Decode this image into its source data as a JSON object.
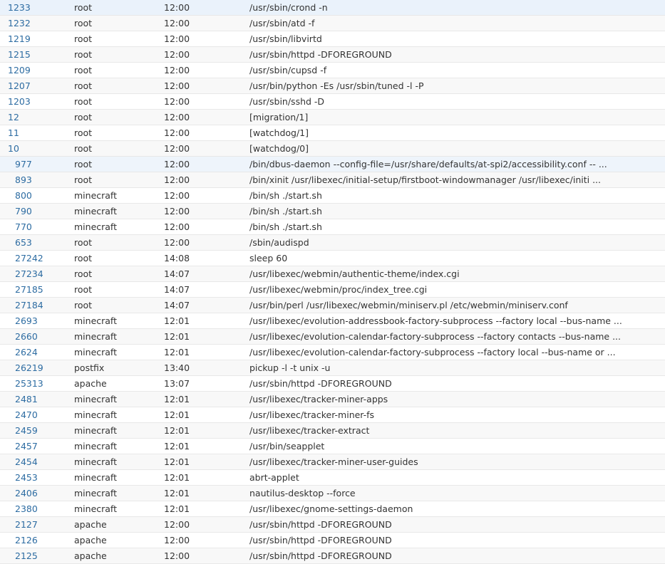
{
  "process_table": {
    "rows": [
      {
        "pid": "1233",
        "owner": "root",
        "started": "12:00",
        "command": "/usr/sbin/crond -n",
        "level": 0
      },
      {
        "pid": "1232",
        "owner": "root",
        "started": "12:00",
        "command": "/usr/sbin/atd -f",
        "level": 0
      },
      {
        "pid": "1219",
        "owner": "root",
        "started": "12:00",
        "command": "/usr/sbin/libvirtd",
        "level": 0
      },
      {
        "pid": "1215",
        "owner": "root",
        "started": "12:00",
        "command": "/usr/sbin/httpd -DFOREGROUND",
        "level": 0
      },
      {
        "pid": "1209",
        "owner": "root",
        "started": "12:00",
        "command": "/usr/sbin/cupsd -f",
        "level": 0
      },
      {
        "pid": "1207",
        "owner": "root",
        "started": "12:00",
        "command": "/usr/bin/python -Es /usr/sbin/tuned -l -P",
        "level": 0
      },
      {
        "pid": "1203",
        "owner": "root",
        "started": "12:00",
        "command": "/usr/sbin/sshd -D",
        "level": 0
      },
      {
        "pid": "12",
        "owner": "root",
        "started": "12:00",
        "command": "[migration/1]",
        "level": 0
      },
      {
        "pid": "11",
        "owner": "root",
        "started": "12:00",
        "command": "[watchdog/1]",
        "level": 0
      },
      {
        "pid": "10",
        "owner": "root",
        "started": "12:00",
        "command": "[watchdog/0]",
        "level": 0
      },
      {
        "pid": "977",
        "owner": "root",
        "started": "12:00",
        "command": "/bin/dbus-daemon --config-file=/usr/share/defaults/at-spi2/accessibility.conf -- ...",
        "level": 1,
        "highlight": true
      },
      {
        "pid": "893",
        "owner": "root",
        "started": "12:00",
        "command": "/bin/xinit /usr/libexec/initial-setup/firstboot-windowmanager /usr/libexec/initi ...",
        "level": 1
      },
      {
        "pid": "800",
        "owner": "minecraft",
        "started": "12:00",
        "command": "/bin/sh ./start.sh",
        "level": 1
      },
      {
        "pid": "790",
        "owner": "minecraft",
        "started": "12:00",
        "command": "/bin/sh ./start.sh",
        "level": 1
      },
      {
        "pid": "770",
        "owner": "minecraft",
        "started": "12:00",
        "command": "/bin/sh ./start.sh",
        "level": 1
      },
      {
        "pid": "653",
        "owner": "root",
        "started": "12:00",
        "command": "/sbin/audispd",
        "level": 1
      },
      {
        "pid": "27242",
        "owner": "root",
        "started": "14:08",
        "command": "sleep 60",
        "level": 1
      },
      {
        "pid": "27234",
        "owner": "root",
        "started": "14:07",
        "command": "/usr/libexec/webmin/authentic-theme/index.cgi",
        "level": 1
      },
      {
        "pid": "27185",
        "owner": "root",
        "started": "14:07",
        "command": "/usr/libexec/webmin/proc/index_tree.cgi",
        "level": 1
      },
      {
        "pid": "27184",
        "owner": "root",
        "started": "14:07",
        "command": "/usr/bin/perl /usr/libexec/webmin/miniserv.pl /etc/webmin/miniserv.conf",
        "level": 1
      },
      {
        "pid": "2693",
        "owner": "minecraft",
        "started": "12:01",
        "command": "/usr/libexec/evolution-addressbook-factory-subprocess --factory local --bus-name ...",
        "level": 1
      },
      {
        "pid": "2660",
        "owner": "minecraft",
        "started": "12:01",
        "command": "/usr/libexec/evolution-calendar-factory-subprocess --factory contacts --bus-name ...",
        "level": 1
      },
      {
        "pid": "2624",
        "owner": "minecraft",
        "started": "12:01",
        "command": "/usr/libexec/evolution-calendar-factory-subprocess --factory local --bus-name or ...",
        "level": 1
      },
      {
        "pid": "26219",
        "owner": "postfix",
        "started": "13:40",
        "command": "pickup -l -t unix -u",
        "level": 1
      },
      {
        "pid": "25313",
        "owner": "apache",
        "started": "13:07",
        "command": "/usr/sbin/httpd -DFOREGROUND",
        "level": 1
      },
      {
        "pid": "2481",
        "owner": "minecraft",
        "started": "12:01",
        "command": "/usr/libexec/tracker-miner-apps",
        "level": 1
      },
      {
        "pid": "2470",
        "owner": "minecraft",
        "started": "12:01",
        "command": "/usr/libexec/tracker-miner-fs",
        "level": 1
      },
      {
        "pid": "2459",
        "owner": "minecraft",
        "started": "12:01",
        "command": "/usr/libexec/tracker-extract",
        "level": 1
      },
      {
        "pid": "2457",
        "owner": "minecraft",
        "started": "12:01",
        "command": "/usr/bin/seapplet",
        "level": 1
      },
      {
        "pid": "2454",
        "owner": "minecraft",
        "started": "12:01",
        "command": "/usr/libexec/tracker-miner-user-guides",
        "level": 1
      },
      {
        "pid": "2453",
        "owner": "minecraft",
        "started": "12:01",
        "command": "abrt-applet",
        "level": 1
      },
      {
        "pid": "2406",
        "owner": "minecraft",
        "started": "12:01",
        "command": "nautilus-desktop --force",
        "level": 1
      },
      {
        "pid": "2380",
        "owner": "minecraft",
        "started": "12:01",
        "command": "/usr/libexec/gnome-settings-daemon",
        "level": 1
      },
      {
        "pid": "2127",
        "owner": "apache",
        "started": "12:00",
        "command": "/usr/sbin/httpd -DFOREGROUND",
        "level": 1
      },
      {
        "pid": "2126",
        "owner": "apache",
        "started": "12:00",
        "command": "/usr/sbin/httpd -DFOREGROUND",
        "level": 1
      },
      {
        "pid": "2125",
        "owner": "apache",
        "started": "12:00",
        "command": "/usr/sbin/httpd -DFOREGROUND",
        "level": 1
      }
    ]
  }
}
